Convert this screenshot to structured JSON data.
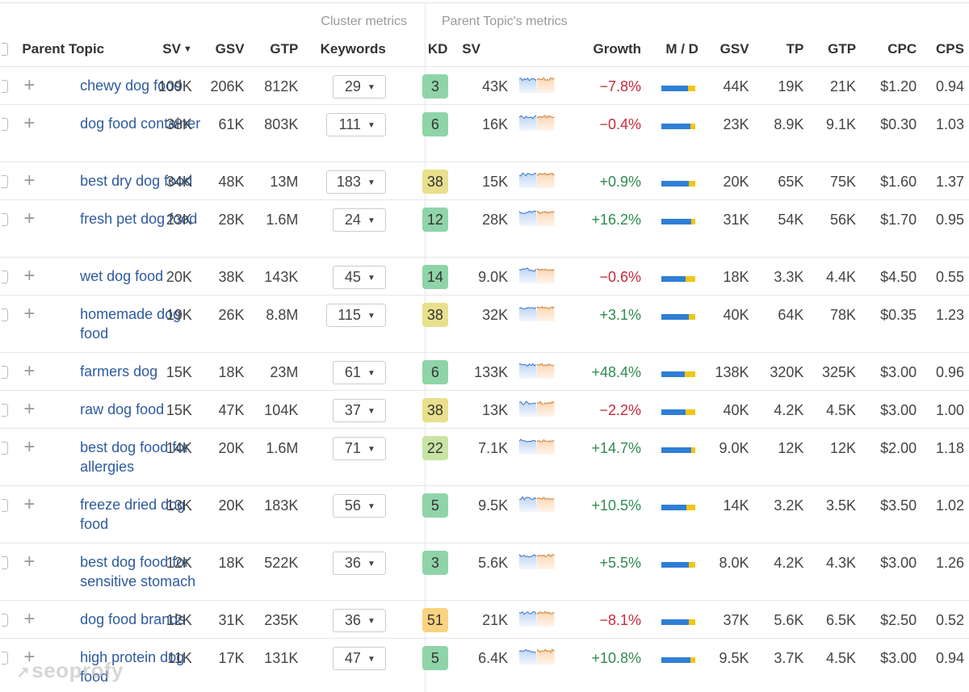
{
  "groups": {
    "cluster": "Cluster metrics",
    "parent": "Parent Topic's metrics"
  },
  "headers": {
    "parent_topic": "Parent Topic",
    "sv": "SV",
    "gsv": "GSV",
    "gtp": "GTP",
    "keywords": "Keywords",
    "kd": "KD",
    "p_sv": "SV",
    "growth": "Growth",
    "md": "M / D",
    "p_gsv": "GSV",
    "tp": "TP",
    "p_gtp": "GTP",
    "cpc": "CPC",
    "cps": "CPS"
  },
  "colors": {
    "kd_green": "#8fd4a8",
    "kd_lightgreen": "#c8e4a4",
    "kd_yellow": "#e8e08c",
    "kd_orange": "#fbd380",
    "link": "#2e5b9e",
    "growth_pos": "#2e8b4f",
    "growth_neg": "#c8283b",
    "md_blue": "#2f7fd6",
    "md_yellow": "#f3c514"
  },
  "rows": [
    {
      "topic": "chewy dog food",
      "sv": "109K",
      "gsv": "206K",
      "gtp": "812K",
      "keywords": "29",
      "kd": "3",
      "kd_level": "green",
      "p_sv": "43K",
      "growth": "−7.8%",
      "growth_dir": "neg",
      "md_mobile": 0.78,
      "p_gsv": "44K",
      "tp": "19K",
      "p_gtp": "21K",
      "cpc": "$1.20",
      "cps": "0.94"
    },
    {
      "topic": "dog food container",
      "sv": "38K",
      "gsv": "61K",
      "gtp": "803K",
      "keywords": "111",
      "kd": "6",
      "kd_level": "green",
      "p_sv": "16K",
      "growth": "−0.4%",
      "growth_dir": "neg",
      "md_mobile": 0.87,
      "p_gsv": "23K",
      "tp": "8.9K",
      "p_gtp": "9.1K",
      "cpc": "$0.30",
      "cps": "1.03"
    },
    {
      "topic": "best dry dog food",
      "sv": "34K",
      "gsv": "48K",
      "gtp": "13M",
      "keywords": "183",
      "kd": "38",
      "kd_level": "yellow",
      "p_sv": "15K",
      "growth": "+0.9%",
      "growth_dir": "pos",
      "md_mobile": 0.8,
      "p_gsv": "20K",
      "tp": "65K",
      "p_gtp": "75K",
      "cpc": "$1.60",
      "cps": "1.37"
    },
    {
      "topic": "fresh pet dog food",
      "sv": "23K",
      "gsv": "28K",
      "gtp": "1.6M",
      "keywords": "24",
      "kd": "12",
      "kd_level": "green",
      "p_sv": "28K",
      "growth": "+16.2%",
      "growth_dir": "pos",
      "md_mobile": 0.88,
      "p_gsv": "31K",
      "tp": "54K",
      "p_gtp": "56K",
      "cpc": "$1.70",
      "cps": "0.95"
    },
    {
      "topic": "wet dog food",
      "sv": "20K",
      "gsv": "38K",
      "gtp": "143K",
      "keywords": "45",
      "kd": "14",
      "kd_level": "green",
      "p_sv": "9.0K",
      "growth": "−0.6%",
      "growth_dir": "neg",
      "md_mobile": 0.72,
      "p_gsv": "18K",
      "tp": "3.3K",
      "p_gtp": "4.4K",
      "cpc": "$4.50",
      "cps": "0.55"
    },
    {
      "topic": "homemade dog food",
      "sv": "19K",
      "gsv": "26K",
      "gtp": "8.8M",
      "keywords": "115",
      "kd": "38",
      "kd_level": "yellow",
      "p_sv": "32K",
      "growth": "+3.1%",
      "growth_dir": "pos",
      "md_mobile": 0.82,
      "p_gsv": "40K",
      "tp": "64K",
      "p_gtp": "78K",
      "cpc": "$0.35",
      "cps": "1.23"
    },
    {
      "topic": "farmers dog",
      "sv": "15K",
      "gsv": "18K",
      "gtp": "23M",
      "keywords": "61",
      "kd": "6",
      "kd_level": "green",
      "p_sv": "133K",
      "growth": "+48.4%",
      "growth_dir": "pos",
      "md_mobile": 0.7,
      "p_gsv": "138K",
      "tp": "320K",
      "p_gtp": "325K",
      "cpc": "$3.00",
      "cps": "0.96"
    },
    {
      "topic": "raw dog food",
      "sv": "15K",
      "gsv": "47K",
      "gtp": "104K",
      "keywords": "37",
      "kd": "38",
      "kd_level": "yellow",
      "p_sv": "13K",
      "growth": "−2.2%",
      "growth_dir": "neg",
      "md_mobile": 0.72,
      "p_gsv": "40K",
      "tp": "4.2K",
      "p_gtp": "4.5K",
      "cpc": "$3.00",
      "cps": "1.00"
    },
    {
      "topic": "best dog food for allergies",
      "sv": "14K",
      "gsv": "20K",
      "gtp": "1.6M",
      "keywords": "71",
      "kd": "22",
      "kd_level": "lightgreen",
      "p_sv": "7.1K",
      "growth": "+14.7%",
      "growth_dir": "pos",
      "md_mobile": 0.88,
      "p_gsv": "9.0K",
      "tp": "12K",
      "p_gtp": "12K",
      "cpc": "$2.00",
      "cps": "1.18"
    },
    {
      "topic": "freeze dried dog food",
      "sv": "13K",
      "gsv": "20K",
      "gtp": "183K",
      "keywords": "56",
      "kd": "5",
      "kd_level": "green",
      "p_sv": "9.5K",
      "growth": "+10.5%",
      "growth_dir": "pos",
      "md_mobile": 0.74,
      "p_gsv": "14K",
      "tp": "3.2K",
      "p_gtp": "3.5K",
      "cpc": "$3.50",
      "cps": "1.02"
    },
    {
      "topic": "best dog food for sensitive stomach",
      "sv": "12K",
      "gsv": "18K",
      "gtp": "522K",
      "keywords": "36",
      "kd": "3",
      "kd_level": "green",
      "p_sv": "5.6K",
      "growth": "+5.5%",
      "growth_dir": "pos",
      "md_mobile": 0.8,
      "p_gsv": "8.0K",
      "tp": "4.2K",
      "p_gtp": "4.3K",
      "cpc": "$3.00",
      "cps": "1.26"
    },
    {
      "topic": "dog food brands",
      "sv": "12K",
      "gsv": "31K",
      "gtp": "235K",
      "keywords": "36",
      "kd": "51",
      "kd_level": "orange",
      "p_sv": "21K",
      "growth": "−8.1%",
      "growth_dir": "neg",
      "md_mobile": 0.82,
      "p_gsv": "37K",
      "tp": "5.6K",
      "p_gtp": "6.5K",
      "cpc": "$2.50",
      "cps": "0.52"
    },
    {
      "topic": "high protein dog food",
      "sv": "11K",
      "gsv": "17K",
      "gtp": "131K",
      "keywords": "47",
      "kd": "5",
      "kd_level": "green",
      "p_sv": "6.4K",
      "growth": "+10.8%",
      "growth_dir": "pos",
      "md_mobile": 0.86,
      "p_gsv": "9.5K",
      "tp": "3.7K",
      "p_gtp": "4.5K",
      "cpc": "$3.00",
      "cps": "0.94"
    }
  ],
  "watermark": "seoprofy"
}
